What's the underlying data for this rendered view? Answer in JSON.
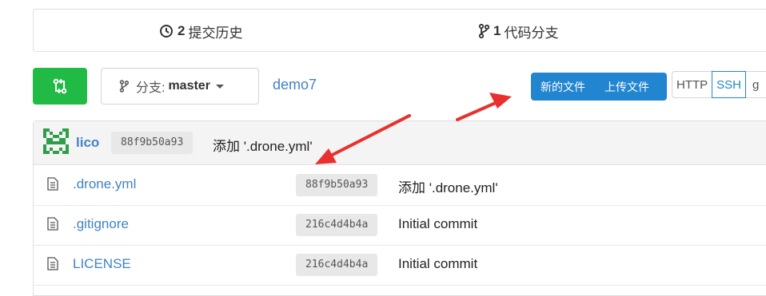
{
  "stats": {
    "commits": {
      "count": "2",
      "label": "提交历史",
      "icon": "history-icon"
    },
    "branches": {
      "count": "1",
      "label": "代码分支",
      "icon": "branch-icon"
    }
  },
  "toolbar": {
    "compare_icon": "compare-icon",
    "branch_label": "分支:",
    "branch_value": "master",
    "repo_name": "demo7",
    "new_file": "新的文件",
    "upload_file": "上传文件",
    "clone_http": "HTTP",
    "clone_ssh": "SSH",
    "clone_url": "g"
  },
  "latest_commit": {
    "author": "lico",
    "sha": "88f9b50a93",
    "message": "添加 '.drone.yml'"
  },
  "files": [
    {
      "name": ".drone.yml",
      "sha": "88f9b50a93",
      "message": "添加 '.drone.yml'"
    },
    {
      "name": ".gitignore",
      "sha": "216c4d4b4a",
      "message": "Initial commit"
    },
    {
      "name": "LICENSE",
      "sha": "216c4d4b4a",
      "message": "Initial commit"
    }
  ],
  "colors": {
    "green": "#21ba45",
    "blue": "#2185d0",
    "link": "#4183c4",
    "annotation_arrow": "#e8312f"
  }
}
